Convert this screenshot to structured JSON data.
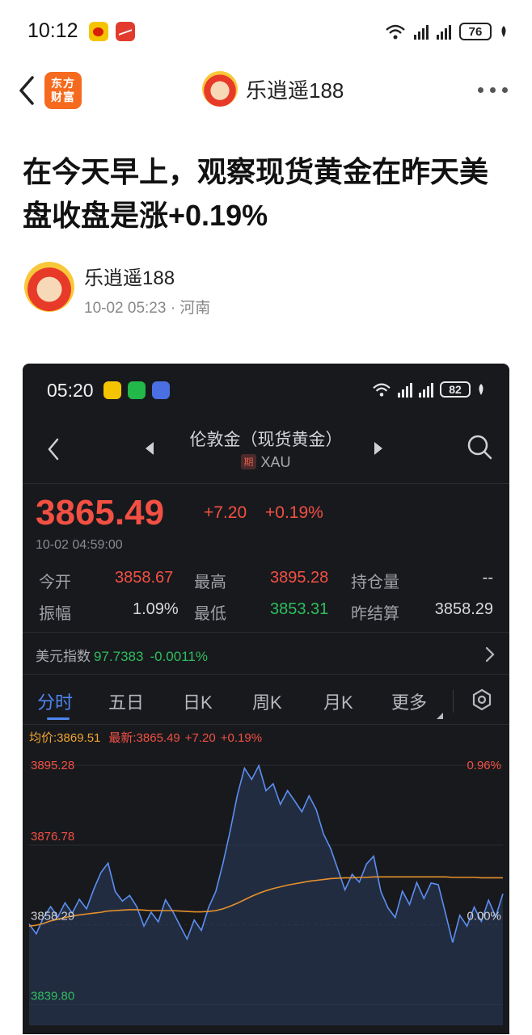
{
  "status_bar": {
    "time": "10:12",
    "battery": "76"
  },
  "nav": {
    "logo_text_1": "东方",
    "logo_text_2": "财富",
    "author_name": "乐逍遥188"
  },
  "article": {
    "title": "在今天早上，观察现货黄金在昨天美盘收盘是涨+0.19%",
    "author": "乐逍遥188",
    "meta": "10-02 05:23 · 河南"
  },
  "screenshot": {
    "status": {
      "time": "05:20",
      "battery": "82"
    },
    "header": {
      "title": "伦敦金（现货黄金）",
      "tag": "期",
      "code": "XAU"
    },
    "quote": {
      "price": "3865.49",
      "change": "+7.20",
      "change_pct": "+0.19%",
      "time": "10-02 04:59:00"
    },
    "stats": [
      {
        "l1": "今开",
        "v1": "3858.67",
        "l2": "最高",
        "v2": "3895.28",
        "l3": "持仓量",
        "v3": "--"
      },
      {
        "l1": "振幅",
        "v1": "1.09%",
        "l2": "最低",
        "v2": "3853.31",
        "l3": "昨结算",
        "v3": "3858.29"
      }
    ],
    "usd_index": {
      "label": "美元指数",
      "value": "97.7383",
      "change": "-0.0011%"
    },
    "tabs": [
      "分时",
      "五日",
      "日K",
      "周K",
      "月K",
      "更多"
    ],
    "avg_line": {
      "avg": "均价:3869.51",
      "latest": "最新:3865.49",
      "chg": "+7.20",
      "pct": "+0.19%"
    }
  },
  "chart_data": {
    "type": "area",
    "y_labels": [
      "3895.28",
      "3876.78",
      "3858.29",
      "3839.80"
    ],
    "right_labels": [
      "0.96%",
      "0.00%"
    ],
    "ylim": [
      3835.0,
      3897.0
    ],
    "prev_close": 3858.29,
    "price_series": [
      3858.5,
      3856.2,
      3860.0,
      3862.5,
      3860.1,
      3863.4,
      3861.0,
      3864.2,
      3862.0,
      3866.5,
      3870.4,
      3872.6,
      3866.0,
      3863.8,
      3865.1,
      3862.5,
      3858.0,
      3861.2,
      3859.0,
      3864.1,
      3861.4,
      3858.2,
      3855.0,
      3859.4,
      3857.0,
      3862.3,
      3866.0,
      3872.5,
      3880.0,
      3888.3,
      3894.6,
      3892.0,
      3895.2,
      3889.4,
      3891.0,
      3886.2,
      3889.4,
      3887.0,
      3884.5,
      3888.2,
      3885.0,
      3879.4,
      3876.0,
      3871.2,
      3866.4,
      3870.0,
      3868.2,
      3872.4,
      3874.2,
      3866.0,
      3862.2,
      3860.0,
      3866.1,
      3863.0,
      3868.1,
      3864.4,
      3868.0,
      3867.6,
      3861.0,
      3854.2,
      3860.5,
      3858.0,
      3862.4,
      3859.1,
      3864.0,
      3860.2,
      3865.5
    ],
    "avg_series": [
      3858.0,
      3858.2,
      3858.6,
      3859.2,
      3859.6,
      3860.0,
      3860.3,
      3860.6,
      3860.8,
      3861.0,
      3861.2,
      3861.5,
      3861.6,
      3861.7,
      3861.8,
      3861.8,
      3861.7,
      3861.6,
      3861.6,
      3861.6,
      3861.6,
      3861.5,
      3861.4,
      3861.3,
      3861.3,
      3861.4,
      3861.6,
      3862.0,
      3862.6,
      3863.3,
      3864.1,
      3864.9,
      3865.6,
      3866.2,
      3866.7,
      3867.1,
      3867.5,
      3867.8,
      3868.1,
      3868.4,
      3868.6,
      3868.8,
      3869.0,
      3869.1,
      3869.2,
      3869.2,
      3869.3,
      3869.3,
      3869.4,
      3869.4,
      3869.4,
      3869.4,
      3869.4,
      3869.4,
      3869.4,
      3869.4,
      3869.4,
      3869.4,
      3869.4,
      3869.3,
      3869.3,
      3869.3,
      3869.3,
      3869.2,
      3869.2,
      3869.2,
      3869.2
    ],
    "colors": {
      "price": "#5b8ff0",
      "avg": "#e6912a",
      "fill": "#2b3d5e"
    }
  }
}
